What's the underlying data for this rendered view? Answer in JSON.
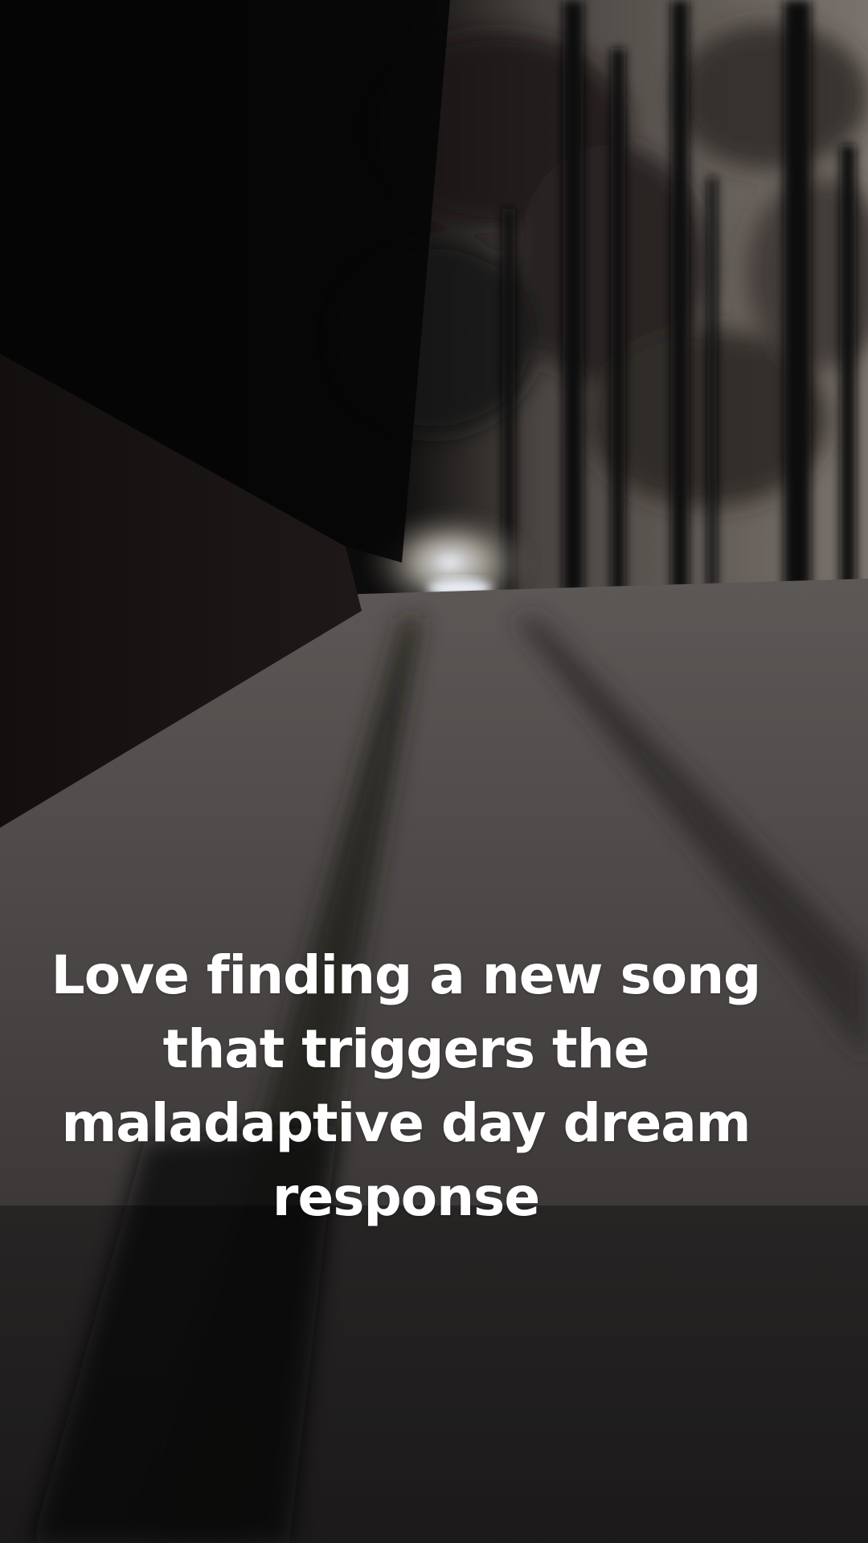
{
  "caption": {
    "text": "Love finding a new song that triggers the maladaptive day dream response"
  },
  "scene": {
    "description_icon": "night-snowy-path-photo",
    "colors": {
      "sky": "#7d7670",
      "snow": "#4f4b49",
      "shadow": "#070606",
      "light": "#e6ecf5"
    }
  }
}
